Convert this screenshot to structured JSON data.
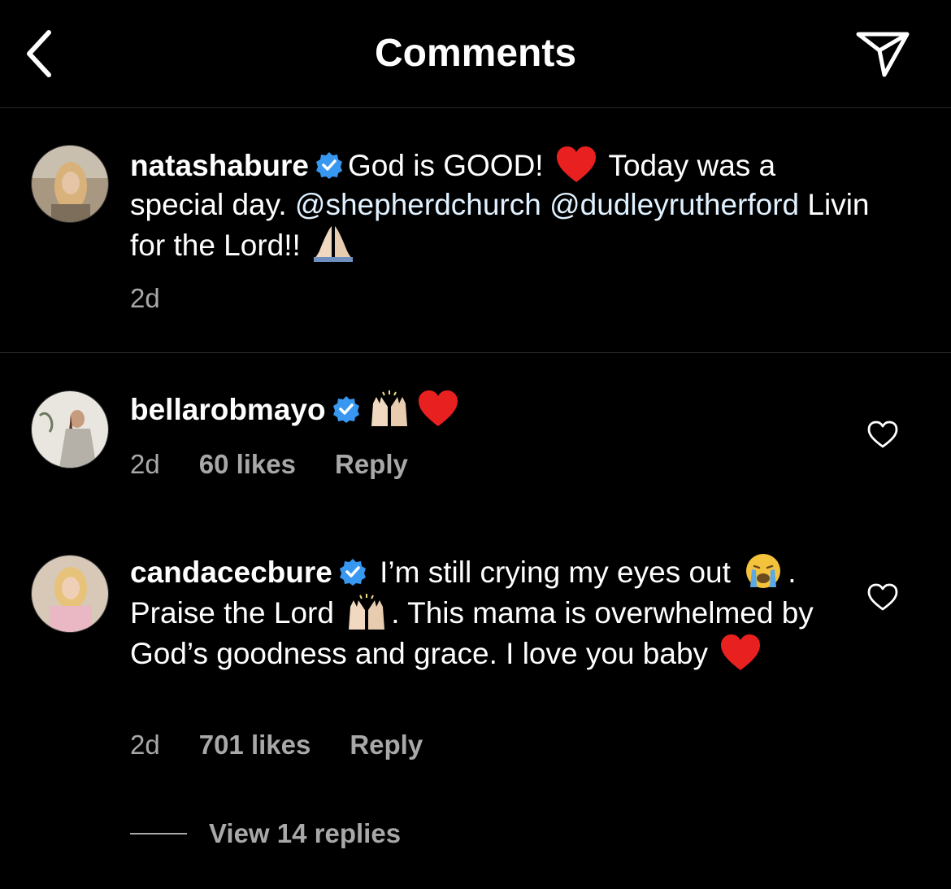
{
  "header": {
    "title": "Comments",
    "back_icon": "chevron-left-icon",
    "send_icon": "paper-plane-icon"
  },
  "caption": {
    "username": "natashabure",
    "verified": true,
    "text_1": "God is GOOD!",
    "text_2": " Today was a special day. ",
    "mention_1": "@shepherdchurch",
    "mention_2": "@dudleyrutherford",
    "text_3": " Livin for the Lord!! ",
    "time": "2d"
  },
  "comments": [
    {
      "username": "bellarobmayo",
      "verified": true,
      "time": "2d",
      "likes": "60 likes",
      "reply": "Reply"
    },
    {
      "username": "candacecbure",
      "verified": true,
      "text_1": " I’m still crying my eyes out ",
      "text_2": ". Praise the Lord ",
      "text_3": ". This mama is overwhelmed by God’s goodness and grace.  I love you baby ",
      "time": "2d",
      "likes": "701 likes",
      "reply": "Reply"
    }
  ],
  "view_replies": "View 14 replies",
  "colors": {
    "background": "#000000",
    "text": "#ffffff",
    "secondary": "#a8a8a8",
    "mention": "#e0f1ff",
    "verified": "#3897f0",
    "heart": "#e8201f"
  }
}
